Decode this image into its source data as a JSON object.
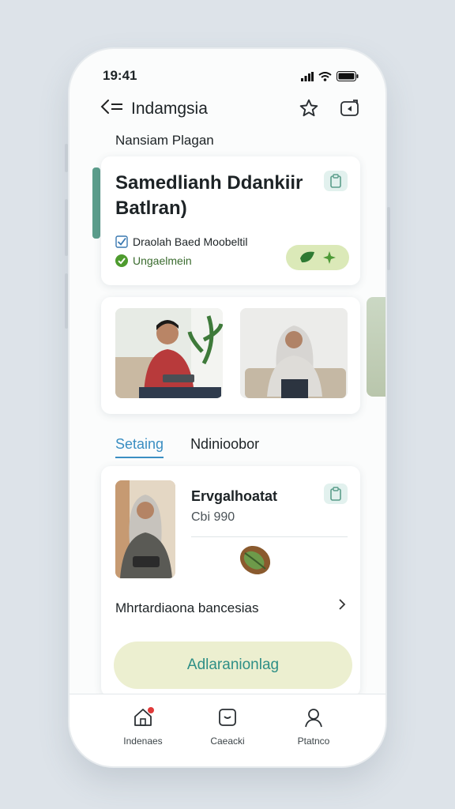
{
  "status_bar": {
    "time": "19:41"
  },
  "nav": {
    "title": "Indamgsia"
  },
  "section_title": "Nansiam Plagan",
  "highlight_card": {
    "headline": "Samedlianh Ddankiir Batlran)",
    "line1": "Draolah Baed Moobeltil",
    "line2": "Ungaelmein"
  },
  "tabs": {
    "active": "Setaing",
    "inactive": "Ndinioobor"
  },
  "profile_card": {
    "name": "Ervgalhoatat",
    "code": "Cbi 990",
    "row_label": "Mhrtardiaona bancesias"
  },
  "cta": {
    "label": "Adlaranionlag"
  },
  "tabbar": {
    "items": [
      "Indenaes",
      "Caeacki",
      "Ptatnco"
    ]
  },
  "colors": {
    "accent": "#5b9d8b",
    "tab_active": "#3a8ec2",
    "cta_bg": "#ecefd0",
    "cta_text": "#2e8f86"
  }
}
